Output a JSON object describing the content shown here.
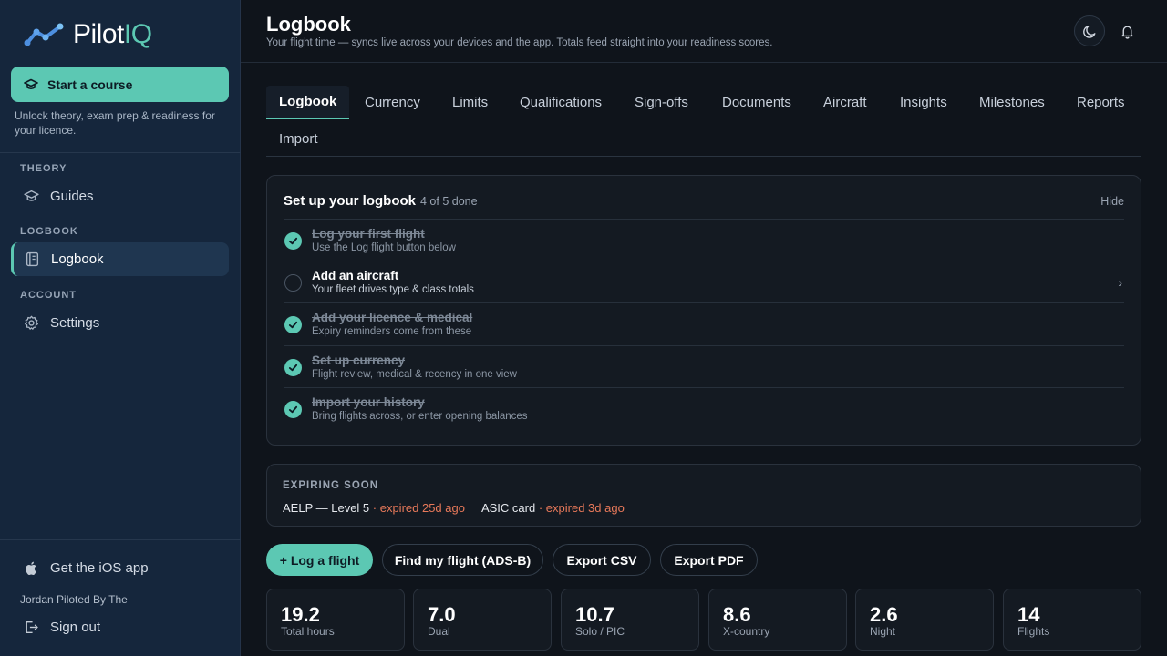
{
  "brand": {
    "name_plain": "Pilot",
    "name_accent": "IQ",
    "accent_color": "#5cc8b3"
  },
  "sidebar": {
    "cta_label": "Start a course",
    "cta_subtext": "Unlock theory, exam prep & readiness for your licence.",
    "sections": [
      {
        "label": "THEORY",
        "item": "Guides"
      },
      {
        "label": "LOGBOOK",
        "item": "Logbook"
      },
      {
        "label": "ACCOUNT",
        "item": "Settings"
      }
    ],
    "ios_link": "Get the iOS app",
    "user_name": "Jordan Piloted By The",
    "sign_out": "Sign out"
  },
  "header": {
    "title": "Logbook",
    "subtitle": "Your flight time — syncs live across your devices and the app. Totals feed straight into your readiness scores."
  },
  "tabs": [
    "Logbook",
    "Currency",
    "Limits",
    "Qualifications",
    "Sign-offs",
    "Documents",
    "Aircraft",
    "Insights",
    "Milestones",
    "Reports",
    "Import"
  ],
  "setup": {
    "title": "Set up your logbook",
    "progress": "4 of 5 done",
    "hide_label": "Hide",
    "tasks": [
      {
        "title": "Log your first flight",
        "sub": "Use the Log flight button below",
        "done": true
      },
      {
        "title": "Add an aircraft",
        "sub": "Your fleet drives type & class totals",
        "done": false
      },
      {
        "title": "Add your licence & medical",
        "sub": "Expiry reminders come from these",
        "done": true
      },
      {
        "title": "Set up currency",
        "sub": "Flight review, medical & recency in one view",
        "done": true
      },
      {
        "title": "Import your history",
        "sub": "Bring flights across, or enter opening balances",
        "done": true
      }
    ]
  },
  "expiring": {
    "label": "EXPIRING SOON",
    "items": [
      {
        "name": "AELP — Level 5",
        "status": "· expired 25d ago"
      },
      {
        "name": "ASIC card",
        "status": "· expired 3d ago"
      }
    ],
    "warn_color": "#e8795a"
  },
  "actions": {
    "log_flight": "+ Log a flight",
    "find_flight": "Find my flight (ADS-B)",
    "export_csv": "Export CSV",
    "export_pdf": "Export PDF"
  },
  "stats": [
    {
      "value": "19.2",
      "label": "Total hours"
    },
    {
      "value": "7.0",
      "label": "Dual"
    },
    {
      "value": "10.7",
      "label": "Solo / PIC"
    },
    {
      "value": "8.6",
      "label": "X-country"
    },
    {
      "value": "2.6",
      "label": "Night"
    },
    {
      "value": "14",
      "label": "Flights"
    }
  ]
}
